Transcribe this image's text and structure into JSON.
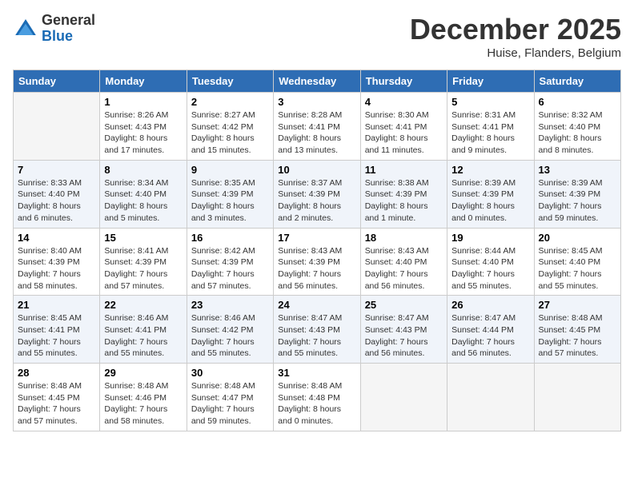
{
  "header": {
    "logo_general": "General",
    "logo_blue": "Blue",
    "month_title": "December 2025",
    "location": "Huise, Flanders, Belgium"
  },
  "days_of_week": [
    "Sunday",
    "Monday",
    "Tuesday",
    "Wednesday",
    "Thursday",
    "Friday",
    "Saturday"
  ],
  "weeks": [
    [
      {
        "day": "",
        "info": ""
      },
      {
        "day": "1",
        "info": "Sunrise: 8:26 AM\nSunset: 4:43 PM\nDaylight: 8 hours\nand 17 minutes."
      },
      {
        "day": "2",
        "info": "Sunrise: 8:27 AM\nSunset: 4:42 PM\nDaylight: 8 hours\nand 15 minutes."
      },
      {
        "day": "3",
        "info": "Sunrise: 8:28 AM\nSunset: 4:41 PM\nDaylight: 8 hours\nand 13 minutes."
      },
      {
        "day": "4",
        "info": "Sunrise: 8:30 AM\nSunset: 4:41 PM\nDaylight: 8 hours\nand 11 minutes."
      },
      {
        "day": "5",
        "info": "Sunrise: 8:31 AM\nSunset: 4:41 PM\nDaylight: 8 hours\nand 9 minutes."
      },
      {
        "day": "6",
        "info": "Sunrise: 8:32 AM\nSunset: 4:40 PM\nDaylight: 8 hours\nand 8 minutes."
      }
    ],
    [
      {
        "day": "7",
        "info": "Sunrise: 8:33 AM\nSunset: 4:40 PM\nDaylight: 8 hours\nand 6 minutes."
      },
      {
        "day": "8",
        "info": "Sunrise: 8:34 AM\nSunset: 4:40 PM\nDaylight: 8 hours\nand 5 minutes."
      },
      {
        "day": "9",
        "info": "Sunrise: 8:35 AM\nSunset: 4:39 PM\nDaylight: 8 hours\nand 3 minutes."
      },
      {
        "day": "10",
        "info": "Sunrise: 8:37 AM\nSunset: 4:39 PM\nDaylight: 8 hours\nand 2 minutes."
      },
      {
        "day": "11",
        "info": "Sunrise: 8:38 AM\nSunset: 4:39 PM\nDaylight: 8 hours\nand 1 minute."
      },
      {
        "day": "12",
        "info": "Sunrise: 8:39 AM\nSunset: 4:39 PM\nDaylight: 8 hours\nand 0 minutes."
      },
      {
        "day": "13",
        "info": "Sunrise: 8:39 AM\nSunset: 4:39 PM\nDaylight: 7 hours\nand 59 minutes."
      }
    ],
    [
      {
        "day": "14",
        "info": "Sunrise: 8:40 AM\nSunset: 4:39 PM\nDaylight: 7 hours\nand 58 minutes."
      },
      {
        "day": "15",
        "info": "Sunrise: 8:41 AM\nSunset: 4:39 PM\nDaylight: 7 hours\nand 57 minutes."
      },
      {
        "day": "16",
        "info": "Sunrise: 8:42 AM\nSunset: 4:39 PM\nDaylight: 7 hours\nand 57 minutes."
      },
      {
        "day": "17",
        "info": "Sunrise: 8:43 AM\nSunset: 4:39 PM\nDaylight: 7 hours\nand 56 minutes."
      },
      {
        "day": "18",
        "info": "Sunrise: 8:43 AM\nSunset: 4:40 PM\nDaylight: 7 hours\nand 56 minutes."
      },
      {
        "day": "19",
        "info": "Sunrise: 8:44 AM\nSunset: 4:40 PM\nDaylight: 7 hours\nand 55 minutes."
      },
      {
        "day": "20",
        "info": "Sunrise: 8:45 AM\nSunset: 4:40 PM\nDaylight: 7 hours\nand 55 minutes."
      }
    ],
    [
      {
        "day": "21",
        "info": "Sunrise: 8:45 AM\nSunset: 4:41 PM\nDaylight: 7 hours\nand 55 minutes."
      },
      {
        "day": "22",
        "info": "Sunrise: 8:46 AM\nSunset: 4:41 PM\nDaylight: 7 hours\nand 55 minutes."
      },
      {
        "day": "23",
        "info": "Sunrise: 8:46 AM\nSunset: 4:42 PM\nDaylight: 7 hours\nand 55 minutes."
      },
      {
        "day": "24",
        "info": "Sunrise: 8:47 AM\nSunset: 4:43 PM\nDaylight: 7 hours\nand 55 minutes."
      },
      {
        "day": "25",
        "info": "Sunrise: 8:47 AM\nSunset: 4:43 PM\nDaylight: 7 hours\nand 56 minutes."
      },
      {
        "day": "26",
        "info": "Sunrise: 8:47 AM\nSunset: 4:44 PM\nDaylight: 7 hours\nand 56 minutes."
      },
      {
        "day": "27",
        "info": "Sunrise: 8:48 AM\nSunset: 4:45 PM\nDaylight: 7 hours\nand 57 minutes."
      }
    ],
    [
      {
        "day": "28",
        "info": "Sunrise: 8:48 AM\nSunset: 4:45 PM\nDaylight: 7 hours\nand 57 minutes."
      },
      {
        "day": "29",
        "info": "Sunrise: 8:48 AM\nSunset: 4:46 PM\nDaylight: 7 hours\nand 58 minutes."
      },
      {
        "day": "30",
        "info": "Sunrise: 8:48 AM\nSunset: 4:47 PM\nDaylight: 7 hours\nand 59 minutes."
      },
      {
        "day": "31",
        "info": "Sunrise: 8:48 AM\nSunset: 4:48 PM\nDaylight: 8 hours\nand 0 minutes."
      },
      {
        "day": "",
        "info": ""
      },
      {
        "day": "",
        "info": ""
      },
      {
        "day": "",
        "info": ""
      }
    ]
  ]
}
